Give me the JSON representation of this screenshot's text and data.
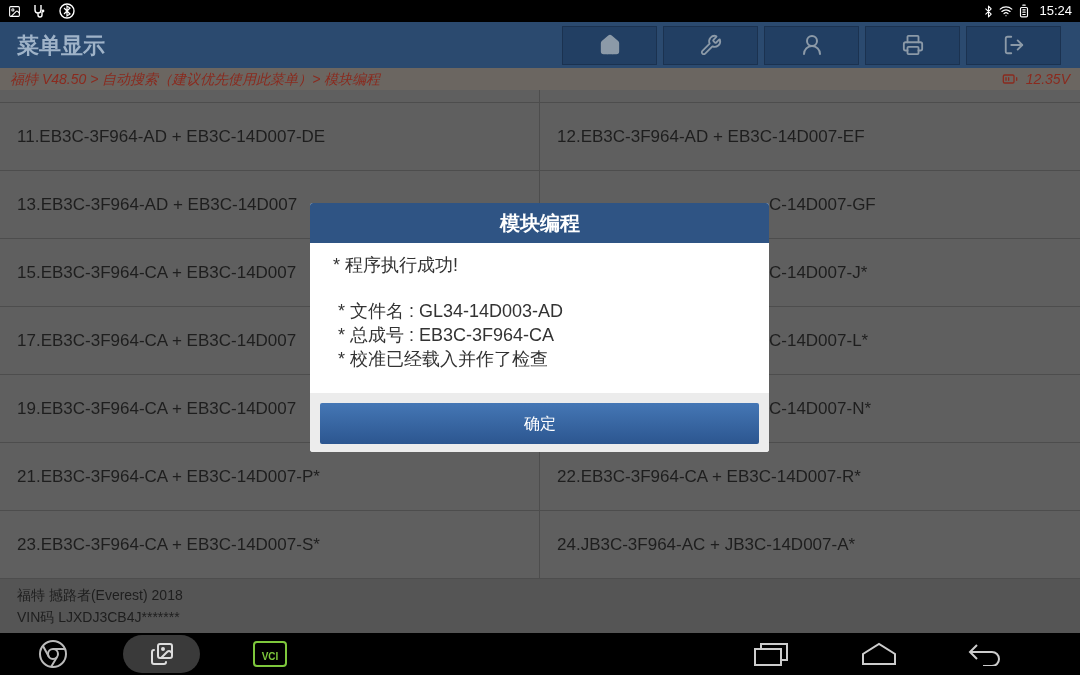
{
  "status_bar": {
    "time": "15:24"
  },
  "header": {
    "title": "菜单显示"
  },
  "breadcrumb": {
    "path": "福特 V48.50 > 自动搜索（建议优先使用此菜单）> 模块编程",
    "voltage": "12.35V"
  },
  "grid": {
    "rows": [
      [
        {
          "kind": "full",
          "text": "11.EB3C-3F964-AD + EB3C-14D007-DE"
        },
        {
          "kind": "full",
          "text": "12.EB3C-3F964-AD + EB3C-14D007-EF"
        }
      ],
      [
        {
          "kind": "full",
          "text": "13.EB3C-3F964-AD + EB3C-14D007"
        },
        {
          "kind": "tail",
          "text": "C-14D007-GF"
        }
      ],
      [
        {
          "kind": "full",
          "text": "15.EB3C-3F964-CA + EB3C-14D007"
        },
        {
          "kind": "tail",
          "text": "C-14D007-J*"
        }
      ],
      [
        {
          "kind": "full",
          "text": "17.EB3C-3F964-CA + EB3C-14D007"
        },
        {
          "kind": "tail",
          "text": "C-14D007-L*"
        }
      ],
      [
        {
          "kind": "full",
          "text": "19.EB3C-3F964-CA + EB3C-14D007"
        },
        {
          "kind": "tail",
          "text": "C-14D007-N*"
        }
      ],
      [
        {
          "kind": "full",
          "text": "21.EB3C-3F964-CA + EB3C-14D007-P*"
        },
        {
          "kind": "full",
          "text": "22.EB3C-3F964-CA + EB3C-14D007-R*"
        }
      ],
      [
        {
          "kind": "full",
          "text": "23.EB3C-3F964-CA + EB3C-14D007-S*"
        },
        {
          "kind": "full",
          "text": "24.JB3C-3F964-AC + JB3C-14D007-A*"
        }
      ]
    ]
  },
  "vehicle": {
    "model": "福特 撼路者(Everest) 2018",
    "vin": "VIN码 LJXDJ3CB4J*******"
  },
  "dialog": {
    "title": "模块编程",
    "lines": [
      "* 程序执行成功!",
      "* 文件名 : GL34-14D003-AD",
      "* 总成号 : EB3C-3F964-CA",
      "* 校准已经载入并作了检查"
    ],
    "button": "确定"
  },
  "nav_bar": {
    "vci_label": "VCI"
  }
}
